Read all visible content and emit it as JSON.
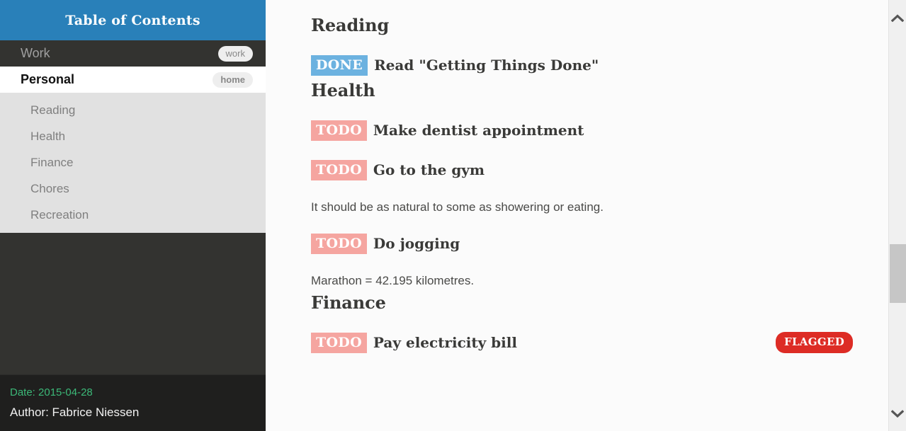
{
  "sidebar": {
    "header": {
      "title": "Table of Contents"
    },
    "entries": [
      {
        "label": "Work",
        "tag": "work",
        "active": false
      },
      {
        "label": "Personal",
        "tag": "home",
        "active": true
      }
    ],
    "sub_entries": [
      {
        "label": "Reading"
      },
      {
        "label": "Health"
      },
      {
        "label": "Finance"
      },
      {
        "label": "Chores"
      },
      {
        "label": "Recreation"
      }
    ],
    "footer": {
      "date": "Date: 2015-04-28",
      "author": "Author: Fabrice Niessen"
    }
  },
  "content": {
    "sections": [
      {
        "title": "Reading",
        "tasks": [
          {
            "keyword": "DONE",
            "text": "Read \"Getting Things Done\"",
            "flag": null
          }
        ]
      },
      {
        "title": "Health",
        "tasks": [
          {
            "keyword": "TODO",
            "text": "Make dentist appointment",
            "flag": null
          },
          {
            "keyword": "TODO",
            "text": "Go to the gym",
            "flag": null
          }
        ],
        "note_1": "It should be as natural to some as showering or eating.",
        "task_3": {
          "keyword": "TODO",
          "text": "Do jogging"
        },
        "note_2": "Marathon = 42.195 kilometres."
      },
      {
        "title": "Finance",
        "tasks": [
          {
            "keyword": "TODO",
            "text": "Pay electricity bill",
            "flag": "FLAGGED"
          }
        ]
      }
    ]
  },
  "scrollbar": {
    "up_arrow": "chevron-up-icon",
    "down_arrow": "chevron-down-icon"
  },
  "colors": {
    "header_blue": "#2980b9",
    "sidebar_dark": "#333330",
    "sub_panel": "#e1e1e1",
    "footer_dark": "#1f1f1e",
    "date_green": "#3cb878",
    "todo_salmon": "#f5a5a0",
    "done_blue": "#6cb2e0",
    "flagged_red": "#dd2c25"
  }
}
